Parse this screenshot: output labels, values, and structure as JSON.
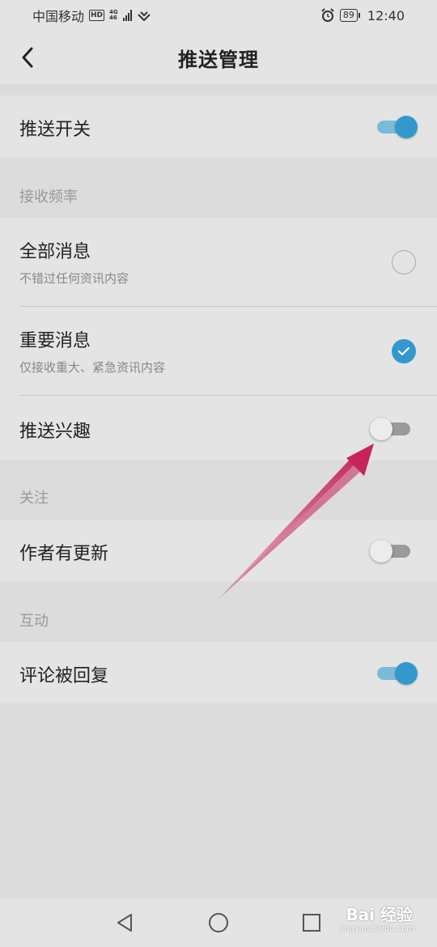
{
  "status_bar": {
    "carrier": "中国移动",
    "hd_badge": "HD",
    "network_top": "4G",
    "network_bottom": "46",
    "battery": "89",
    "time": "12:40"
  },
  "header": {
    "title": "推送管理"
  },
  "push_switch": {
    "label": "推送开关",
    "on": true
  },
  "frequency_section": {
    "label": "接收频率"
  },
  "frequency_options": [
    {
      "label": "全部消息",
      "sub": "不错过任何资讯内容",
      "checked": false
    },
    {
      "label": "重要消息",
      "sub": "仅接收重大、紧急资讯内容",
      "checked": true
    }
  ],
  "push_interest": {
    "label": "推送兴趣",
    "on": false
  },
  "follow_section": {
    "label": "关注"
  },
  "author_update": {
    "label": "作者有更新",
    "on": false
  },
  "interaction_section": {
    "label": "互动"
  },
  "comment_reply": {
    "label": "评论被回复",
    "on": true
  },
  "colors": {
    "accent": "#3399cc",
    "accent_track": "#7bbad8",
    "annotation_arrow": "#c8245a"
  },
  "watermark": {
    "text": "Bai 经验",
    "sub": "jingyan.baidu.com"
  }
}
